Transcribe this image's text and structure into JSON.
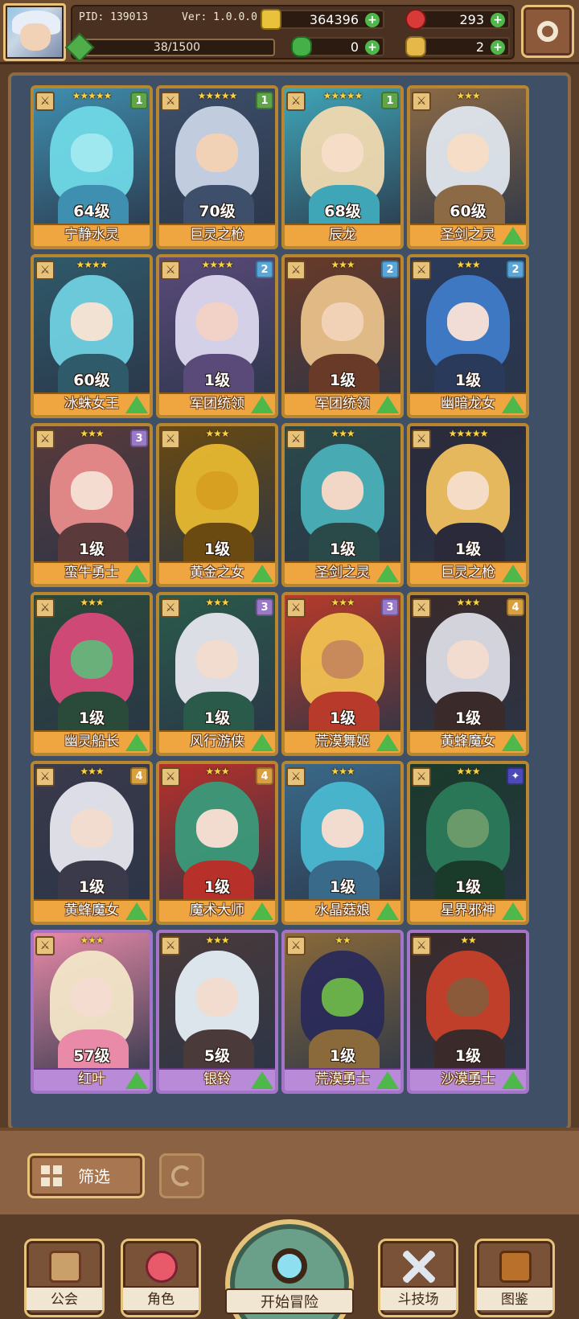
{
  "player": {
    "pid_label": "PID: 139013",
    "version_label": "Ver: 1.0.0.0",
    "exp_text": "38/1500",
    "exp_progress": 0.0253
  },
  "currencies": {
    "gold": "364396",
    "gem": "293",
    "clover": "0",
    "key": "2"
  },
  "icons": {
    "gold": "gold-coin-icon",
    "gem": "red-gem-icon",
    "clover": "clover-icon",
    "key": "key-icon",
    "settings": "gear-icon",
    "filter": "grid-icon",
    "refresh": "refresh-icon"
  },
  "heroes": [
    {
      "name": "宁静水灵",
      "level": "64级",
      "stars": "★★★★★",
      "badge": "1",
      "badge_color": "#5fa64a",
      "rarity": "gold",
      "upgrade": false,
      "palette": [
        "#6fd8e6",
        "#9fe8f0",
        "#3f8fb0"
      ]
    },
    {
      "name": "巨灵之枪",
      "level": "70级",
      "stars": "★★★★★",
      "badge": "1",
      "badge_color": "#5fa64a",
      "rarity": "gold",
      "upgrade": false,
      "palette": [
        "#c9d4e6",
        "#f2d2b6",
        "#3d4f6a"
      ]
    },
    {
      "name": "辰龙",
      "level": "68级",
      "stars": "★★★★★",
      "badge": "1",
      "badge_color": "#5fa64a",
      "rarity": "gold",
      "upgrade": false,
      "palette": [
        "#efd9b0",
        "#f5ddc8",
        "#3fa6b8"
      ]
    },
    {
      "name": "圣剑之灵",
      "level": "60级",
      "stars": "★★★",
      "badge": "",
      "badge_color": "",
      "rarity": "gold",
      "upgrade": true,
      "palette": [
        "#dfe6ee",
        "#f5ddc8",
        "#8c6a45"
      ]
    },
    {
      "name": "冰蛛女王",
      "level": "60级",
      "stars": "★★★★",
      "badge": "",
      "badge_color": "",
      "rarity": "gold",
      "upgrade": true,
      "palette": [
        "#6fd0e0",
        "#f2e2d4",
        "#2f5a6a"
      ]
    },
    {
      "name": "军团统领",
      "level": "1级",
      "stars": "★★★★",
      "badge": "2",
      "badge_color": "#5aa6d8",
      "rarity": "gold",
      "upgrade": true,
      "palette": [
        "#dcd8ee",
        "#f2d2c6",
        "#5a4a7a"
      ]
    },
    {
      "name": "军团统领",
      "level": "1级",
      "stars": "★★★",
      "badge": "2",
      "badge_color": "#5aa6d8",
      "rarity": "gold",
      "upgrade": true,
      "palette": [
        "#e8c08a",
        "#f2d2b6",
        "#6a3a28"
      ]
    },
    {
      "name": "幽暗龙女",
      "level": "1级",
      "stars": "★★★",
      "badge": "2",
      "badge_color": "#5aa6d8",
      "rarity": "gold",
      "upgrade": true,
      "palette": [
        "#3f7ac8",
        "#f2dcd6",
        "#2a3a5a"
      ]
    },
    {
      "name": "蛮牛勇士",
      "level": "1级",
      "stars": "★★★",
      "badge": "3",
      "badge_color": "#9a7ac8",
      "rarity": "gold",
      "upgrade": true,
      "palette": [
        "#e88a8a",
        "#f5dcd0",
        "#5a3a3a"
      ]
    },
    {
      "name": "黄金之女",
      "level": "1级",
      "stars": "★★★",
      "badge": "",
      "badge_color": "",
      "rarity": "gold",
      "upgrade": true,
      "palette": [
        "#e6b830",
        "#d8a020",
        "#6a4a10"
      ]
    },
    {
      "name": "圣剑之灵",
      "level": "1级",
      "stars": "★★★",
      "badge": "",
      "badge_color": "",
      "rarity": "gold",
      "upgrade": true,
      "palette": [
        "#4ab0b8",
        "#f2d6c6",
        "#2a4a4a"
      ]
    },
    {
      "name": "巨灵之枪",
      "level": "1级",
      "stars": "★★★★★",
      "badge": "",
      "badge_color": "",
      "rarity": "gold",
      "upgrade": true,
      "palette": [
        "#f0c060",
        "#f5dcc6",
        "#2a2a3a"
      ]
    },
    {
      "name": "幽灵船长",
      "level": "1级",
      "stars": "★★★",
      "badge": "",
      "badge_color": "",
      "rarity": "gold",
      "upgrade": true,
      "palette": [
        "#d84a7a",
        "#6ab07a",
        "#2a4a3a"
      ]
    },
    {
      "name": "风行游侠",
      "level": "1级",
      "stars": "★★★",
      "badge": "3",
      "badge_color": "#9a7ac8",
      "rarity": "gold",
      "upgrade": true,
      "palette": [
        "#e6e6ee",
        "#f2dcd0",
        "#2a5a4a"
      ]
    },
    {
      "name": "荒漠舞姬",
      "level": "1级",
      "stars": "★★★",
      "badge": "3",
      "badge_color": "#9a7ac8",
      "rarity": "gold",
      "upgrade": true,
      "palette": [
        "#f0c050",
        "#c88a5a",
        "#b83a2a"
      ]
    },
    {
      "name": "黄蜂魔女",
      "level": "1级",
      "stars": "★★★",
      "badge": "4",
      "badge_color": "#d8a040",
      "rarity": "gold",
      "upgrade": true,
      "palette": [
        "#dcdce6",
        "#f2dcd0",
        "#3a2a2a"
      ]
    },
    {
      "name": "黄蜂魔女",
      "level": "1级",
      "stars": "★★★",
      "badge": "4",
      "badge_color": "#d8a040",
      "rarity": "gold",
      "upgrade": true,
      "palette": [
        "#e6e6ee",
        "#f2dcd0",
        "#3a3a4a"
      ]
    },
    {
      "name": "魔术大师",
      "level": "1级",
      "stars": "★★★",
      "badge": "4",
      "badge_color": "#d8a040",
      "rarity": "gold",
      "upgrade": true,
      "palette": [
        "#3a9a7a",
        "#f2dcd0",
        "#b8302a"
      ]
    },
    {
      "name": "水晶菇娘",
      "level": "1级",
      "stars": "★★★",
      "badge": "",
      "badge_color": "",
      "rarity": "gold",
      "upgrade": true,
      "palette": [
        "#4ab8d0",
        "#f2dcd0",
        "#3a6a8a"
      ]
    },
    {
      "name": "星界邪神",
      "level": "1级",
      "stars": "★★★",
      "badge": "✦",
      "badge_color": "#4a4ab8",
      "rarity": "gold",
      "upgrade": true,
      "palette": [
        "#2a7a5a",
        "#6a9a6a",
        "#1a3a2a"
      ]
    },
    {
      "name": "红叶",
      "level": "57级",
      "stars": "★★★",
      "badge": "",
      "badge_color": "",
      "rarity": "purple",
      "upgrade": true,
      "palette": [
        "#f2e6c8",
        "#f5dcd0",
        "#e88aa8"
      ]
    },
    {
      "name": "银铃",
      "level": "5级",
      "stars": "★★★",
      "badge": "",
      "badge_color": "",
      "rarity": "purple",
      "upgrade": true,
      "palette": [
        "#e6eef6",
        "#f2dcd0",
        "#4a3a3a"
      ]
    },
    {
      "name": "荒漠勇士",
      "level": "1级",
      "stars": "★★",
      "badge": "",
      "badge_color": "",
      "rarity": "purple",
      "upgrade": true,
      "palette": [
        "#2a2a5a",
        "#6ab04a",
        "#8a6a3a"
      ]
    },
    {
      "name": "沙漠勇士",
      "level": "1级",
      "stars": "★★",
      "badge": "",
      "badge_color": "",
      "rarity": "purple",
      "upgrade": true,
      "palette": [
        "#c8402a",
        "#8a5a3a",
        "#3a2a2a"
      ]
    }
  ],
  "filter": {
    "label": "筛选"
  },
  "nav": {
    "guild": "公会",
    "character": "角色",
    "adventure": "开始冒险",
    "arena": "斗技场",
    "codex": "图鉴"
  },
  "colors": {
    "gold_frame": "#b8862f",
    "purple_frame": "#a474c9",
    "name_bar_gold": "#f0a640",
    "name_bar_purple": "#b88ad8",
    "upgrade_arrow": "#4fb84a",
    "panel_bg": "#3e4f66"
  }
}
